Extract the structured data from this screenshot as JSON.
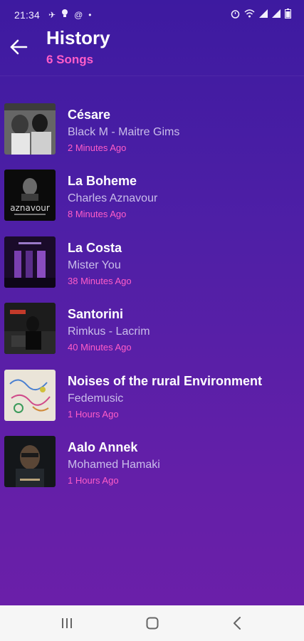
{
  "status_bar": {
    "time": "21:34",
    "left_icons": [
      "airplane-icon",
      "lightbulb-icon",
      "at-sign-icon",
      "dot-icon"
    ],
    "right_icons": [
      "alarm-icon",
      "wifi-icon",
      "signal-icon",
      "signal-icon",
      "battery-icon"
    ]
  },
  "header": {
    "title": "History",
    "subtitle": "6 Songs"
  },
  "songs": [
    {
      "title": "Césare",
      "artist": "Black M - Maitre Gims",
      "time": "2 Minutes Ago"
    },
    {
      "title": "La Boheme",
      "artist": "Charles Aznavour",
      "time": "8 Minutes Ago",
      "cover_text": "aznavour"
    },
    {
      "title": "La Costa",
      "artist": "Mister You",
      "time": "38 Minutes Ago"
    },
    {
      "title": "Santorini",
      "artist": "Rimkus - Lacrim",
      "time": "40 Minutes Ago"
    },
    {
      "title": "Noises of the rural Environment",
      "artist": "Fedemusic",
      "time": "1 Hours Ago"
    },
    {
      "title": "Aalo Annek",
      "artist": "Mohamed Hamaki",
      "time": "1 Hours Ago"
    }
  ],
  "colors": {
    "accent_pink": "#ff5dc8",
    "background_top": "#3d1aa0",
    "background_bottom": "#6c1fa9",
    "artist_text": "#c9bdea"
  },
  "nav_bar": {
    "icons": [
      "recent-apps-icon",
      "home-icon",
      "back-icon"
    ]
  }
}
